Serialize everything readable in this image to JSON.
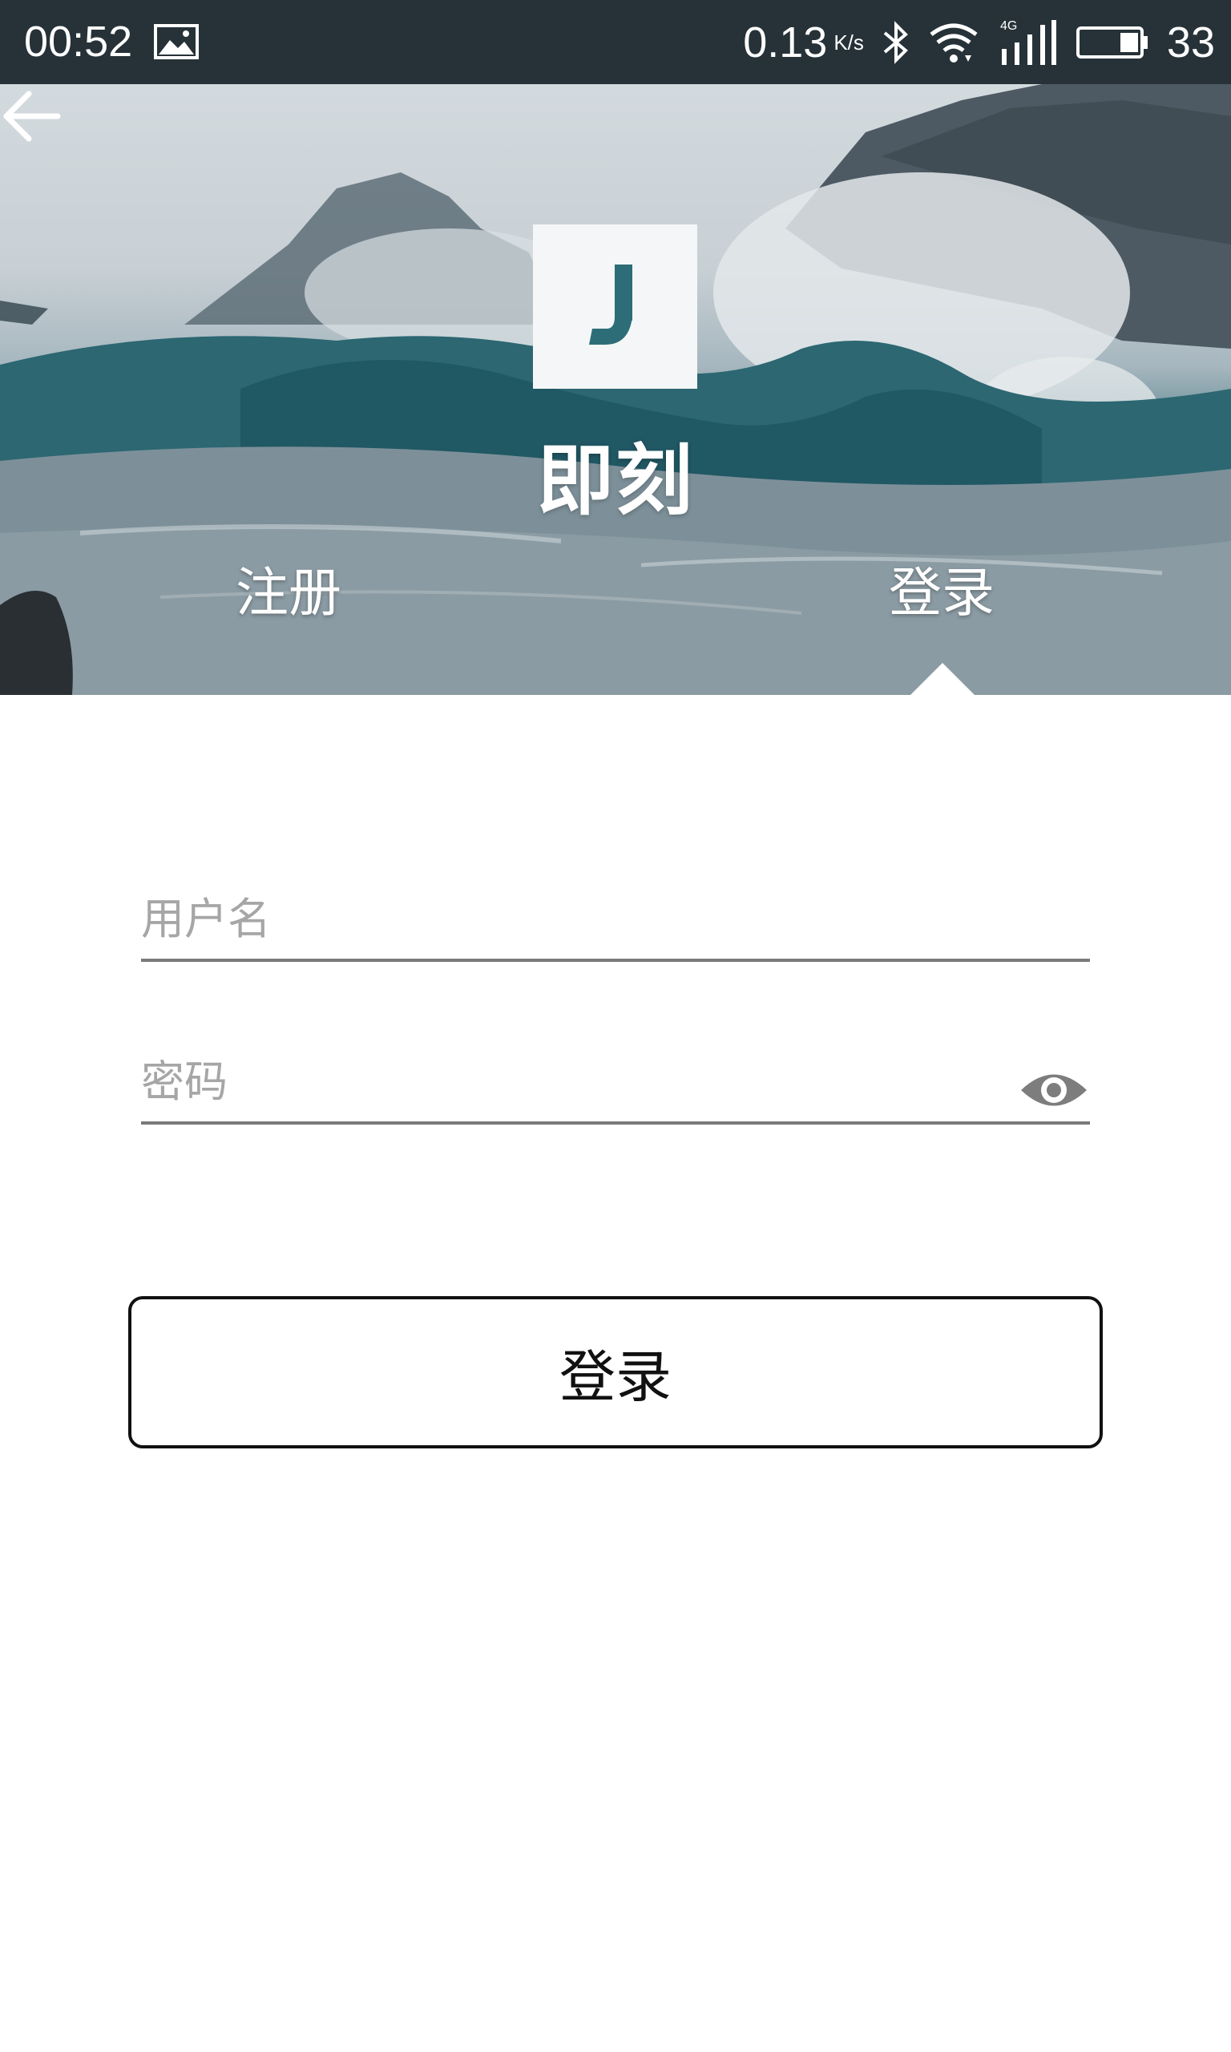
{
  "status_bar": {
    "time": "00:52",
    "net_speed": "0.13",
    "net_unit": "K/s",
    "network_type": "4G",
    "battery_level": "33",
    "icons": [
      "gallery-icon",
      "bluetooth-icon",
      "wifi-icon",
      "signal-icon",
      "battery-icon"
    ]
  },
  "header": {
    "logo_letter": "J",
    "app_name": "即刻",
    "tabs": [
      {
        "label": "注册",
        "selected": false
      },
      {
        "label": "登录",
        "selected": true
      }
    ]
  },
  "form": {
    "username": {
      "placeholder": "用户名",
      "value": ""
    },
    "password": {
      "placeholder": "密码",
      "value": ""
    }
  },
  "actions": {
    "login_label": "登录"
  },
  "colors": {
    "status_bar": "#263238",
    "field_underline": "#7a7a7a",
    "placeholder": "#a6a6a6",
    "button_border": "#111111"
  }
}
